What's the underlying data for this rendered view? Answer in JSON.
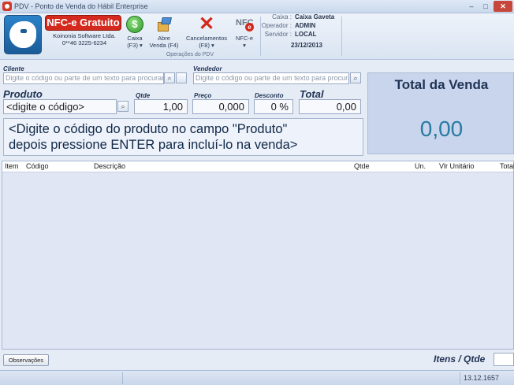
{
  "window": {
    "title": "PDV - Ponto de Venda do Hábil Enterprise",
    "min_glyph": "–",
    "max_glyph": "□",
    "close_glyph": "✕"
  },
  "ribbon": {
    "promo": {
      "badge": "NFC-e Gratuito",
      "company": "Koinonia Software Ltda.",
      "phone": "0**46 3225-6234"
    },
    "buttons": [
      {
        "label": "Caixa",
        "sub": "(F3) ▾",
        "icon": "coin-icon",
        "glyph": "$"
      },
      {
        "label": "Abre",
        "sub": "Venda (F4)",
        "icon": "open-sale-icon"
      },
      {
        "label": "Cancelamentos",
        "sub": "(F8) ▾",
        "icon": "cancel-icon",
        "glyph": "✕"
      },
      {
        "label": "NFC-e",
        "sub": "▾",
        "icon": "nfce-icon",
        "glyph": "NFC",
        "glyph_badge": "e"
      }
    ],
    "group_caption": "Operações do PDV",
    "info": {
      "caixa_label": "Caixa :",
      "caixa_value": "Caixa Gaveta",
      "operador_label": "Operador :",
      "operador_value": "ADMIN",
      "servidor_label": "Servidor :",
      "servidor_value": "LOCAL",
      "date": "23/12/2013"
    }
  },
  "cliente": {
    "label": "Cliente",
    "placeholder": "Digite o código ou parte de um texto para procurar"
  },
  "vendedor": {
    "label": "Vendedor",
    "placeholder": "Digite o código ou parte de um texto para procurar"
  },
  "produto": {
    "label": "Produto",
    "value": "<digite o código>"
  },
  "qtde": {
    "label": "Qtde",
    "value": "1,00"
  },
  "preco": {
    "label": "Preço",
    "value": "0,000"
  },
  "desconto": {
    "label": "Desconto",
    "value": "0 %"
  },
  "total": {
    "label": "Total",
    "value": "0,00"
  },
  "message": {
    "line1": "<Digite o código do produto no campo \"Produto\"",
    "line2": "depois pressione ENTER para incluí-lo na venda>"
  },
  "total_venda": {
    "title": "Total da Venda",
    "value": "0,00"
  },
  "grid": {
    "columns": [
      "Item",
      "Código",
      "Descrição",
      "Qtde",
      "Un.",
      "Vlr Unitário",
      "Total"
    ]
  },
  "footer": {
    "observacoes": "Observações",
    "itens_label": "Itens / Qtde",
    "version": "13.12.1657"
  },
  "icons": {
    "search": "⌕"
  },
  "colors": {
    "accent_red": "#d42a1e",
    "total_value": "#2a7aa3",
    "panel": "#c8d5ec"
  }
}
